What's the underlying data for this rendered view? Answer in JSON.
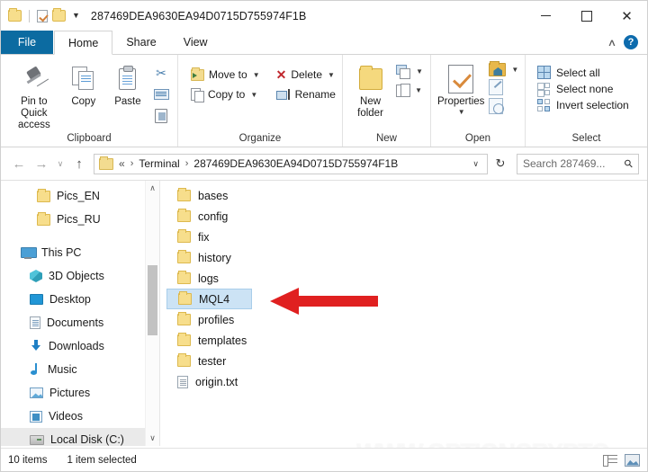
{
  "window": {
    "title": "287469DEA9630EA94D0715D755974F1B",
    "quick_access": [
      {
        "name": "folder-icon"
      },
      {
        "name": "properties-icon"
      },
      {
        "name": "new-folder-icon"
      },
      {
        "name": "customize-qat-chevron"
      }
    ],
    "controls": {
      "minimize": "–",
      "maximize": "□",
      "close": "✕"
    }
  },
  "ribbon": {
    "tabs": [
      {
        "label": "File",
        "type": "file"
      },
      {
        "label": "Home",
        "type": "active"
      },
      {
        "label": "Share",
        "type": "normal"
      },
      {
        "label": "View",
        "type": "normal"
      }
    ],
    "collapse_label": "∧",
    "help_label": "?",
    "groups": [
      {
        "label": "Clipboard",
        "buttons": [
          {
            "label": "Pin to Quick access",
            "icon": "pin-icon"
          },
          {
            "label": "Copy",
            "icon": "copy-icon"
          },
          {
            "label": "Paste",
            "icon": "paste-icon"
          }
        ],
        "small_buttons": [
          {
            "label": "Cut",
            "icon": "scissors-icon"
          },
          {
            "label": "Copy path",
            "icon": "copy-path-icon"
          },
          {
            "label": "Paste shortcut",
            "icon": "paste-shortcut-icon"
          }
        ]
      },
      {
        "label": "Organize",
        "items": [
          {
            "label": "Move to",
            "icon": "move-to-icon",
            "dropdown": true
          },
          {
            "label": "Copy to",
            "icon": "copy-to-icon",
            "dropdown": true
          },
          {
            "label": "Delete",
            "icon": "delete-icon",
            "dropdown": true
          },
          {
            "label": "Rename",
            "icon": "rename-icon",
            "dropdown": false
          }
        ]
      },
      {
        "label": "New",
        "big": {
          "label": "New folder",
          "icon": "new-folder-icon"
        },
        "items": [
          {
            "label": "New item",
            "icon": "new-item-icon",
            "dropdown": true
          },
          {
            "label": "Easy access",
            "icon": "easy-access-icon",
            "dropdown": true
          }
        ]
      },
      {
        "label": "Open",
        "big": {
          "label": "Properties",
          "icon": "properties-icon",
          "dropdown": true
        },
        "items": [
          {
            "label": "Open",
            "icon": "open-folder-icon",
            "dropdown": true
          },
          {
            "label": "Edit",
            "icon": "edit-icon"
          },
          {
            "label": "History",
            "icon": "history-icon"
          }
        ]
      },
      {
        "label": "Select",
        "items": [
          {
            "label": "Select all",
            "icon": "select-all-icon"
          },
          {
            "label": "Select none",
            "icon": "select-none-icon"
          },
          {
            "label": "Invert selection",
            "icon": "invert-selection-icon"
          }
        ]
      }
    ]
  },
  "address": {
    "back": "←",
    "forward": "→",
    "recent": "∨",
    "up": "↑",
    "prefix": "«",
    "crumbs": [
      "Terminal",
      "287469DEA9630EA94D0715D755974F1B"
    ],
    "separator": "›",
    "dropdown": "∨",
    "refresh": "↻",
    "search_placeholder": "Search 287469...",
    "search_icon": "search-icon"
  },
  "nav_pane": {
    "items": [
      {
        "label": "Pics_EN",
        "icon": "folder-icon",
        "indent": "indent2",
        "selected": false
      },
      {
        "label": "Pics_RU",
        "icon": "folder-icon",
        "indent": "indent2",
        "selected": false
      },
      {
        "label": "This PC",
        "icon": "this-pc-icon",
        "indent": "root",
        "selected": false
      },
      {
        "label": "3D Objects",
        "icon": "3d-objects-icon",
        "indent": "",
        "selected": false
      },
      {
        "label": "Desktop",
        "icon": "desktop-icon",
        "indent": "",
        "selected": false
      },
      {
        "label": "Documents",
        "icon": "documents-icon",
        "indent": "",
        "selected": false
      },
      {
        "label": "Downloads",
        "icon": "downloads-icon",
        "indent": "",
        "selected": false
      },
      {
        "label": "Music",
        "icon": "music-icon",
        "indent": "",
        "selected": false
      },
      {
        "label": "Pictures",
        "icon": "pictures-icon",
        "indent": "",
        "selected": false
      },
      {
        "label": "Videos",
        "icon": "videos-icon",
        "indent": "",
        "selected": false
      },
      {
        "label": "Local Disk (C:)",
        "icon": "local-disk-icon",
        "indent": "",
        "selected": true
      }
    ],
    "scroll_up": "∧",
    "scroll_down": "∨"
  },
  "file_list": {
    "items": [
      {
        "name": "bases",
        "type": "folder",
        "selected": false
      },
      {
        "name": "config",
        "type": "folder",
        "selected": false
      },
      {
        "name": "fix",
        "type": "folder",
        "selected": false
      },
      {
        "name": "history",
        "type": "folder",
        "selected": false
      },
      {
        "name": "logs",
        "type": "folder",
        "selected": false
      },
      {
        "name": "MQL4",
        "type": "folder",
        "selected": true
      },
      {
        "name": "profiles",
        "type": "folder",
        "selected": false
      },
      {
        "name": "templates",
        "type": "folder",
        "selected": false
      },
      {
        "name": "tester",
        "type": "folder",
        "selected": false
      },
      {
        "name": "origin.txt",
        "type": "file",
        "selected": false
      }
    ]
  },
  "annotation": {
    "arrow_color": "#e02020",
    "points_to": "MQL4"
  },
  "watermark": {
    "text": "WWW.OPTIONCRYPTO"
  },
  "status_bar": {
    "item_count": "10 items",
    "selection": "1 item selected",
    "views": [
      {
        "name": "details-view-button"
      },
      {
        "name": "large-icons-view-button"
      }
    ]
  }
}
